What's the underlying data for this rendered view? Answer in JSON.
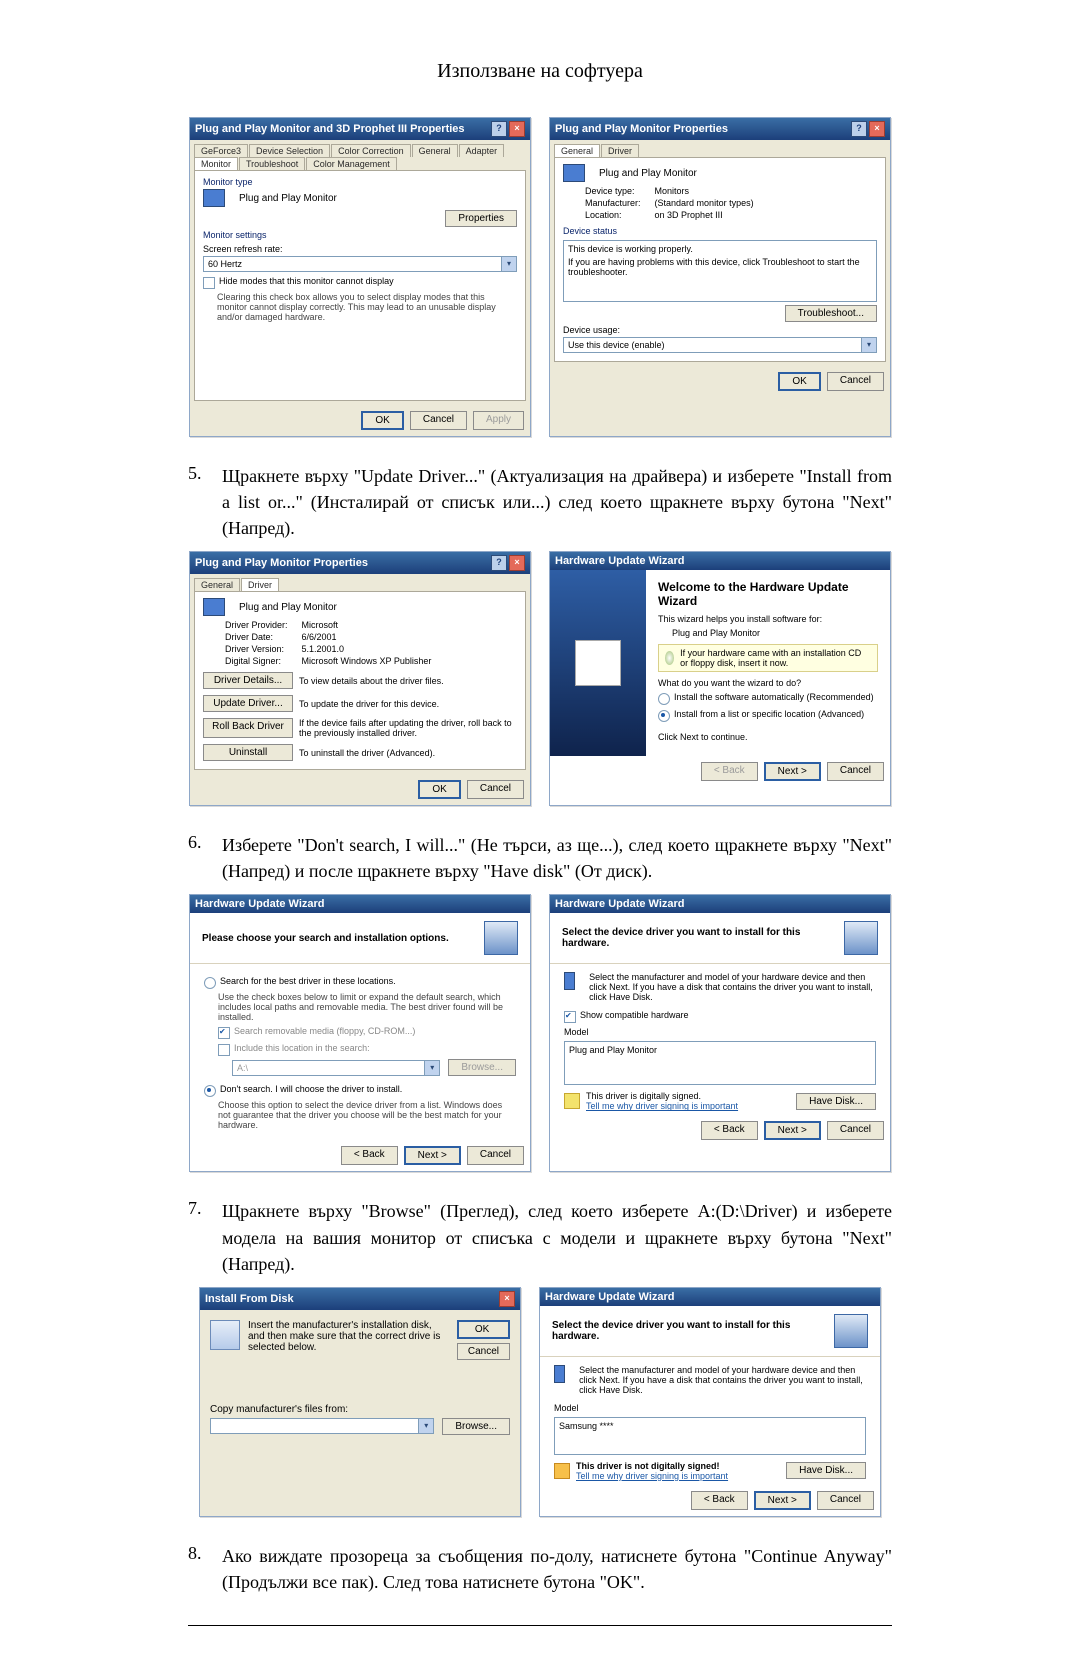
{
  "page_title": "Използване на софтуера",
  "steps": {
    "s5": {
      "num": "5.",
      "text": "Щракнете върху \"Update Driver...\" (Актуализация на драйвера) и изберете \"Install from a list or...\" (Инсталирай от списък или...) след което щракнете върху бутона \"Next\" (Напред)."
    },
    "s6": {
      "num": "6.",
      "text": "Изберете \"Don't search, I will...\" (Не търси, аз ще...), след което щракнете върху \"Next\" (Напред) и после щракнете върху \"Have disk\" (От диск)."
    },
    "s7": {
      "num": "7.",
      "text": "Щракнете върху \"Browse\" (Преглед), след което изберете A:(D:\\Driver) и изберете модела на вашия монитор от списъка с модели и щракнете върху бутона \"Next\" (Напред)."
    },
    "s8": {
      "num": "8.",
      "text": "Ако виждате прозореца за съобщения по-долу, натиснете бутона \"Continue Anyway\" (Продължи все пак). След това натиснете бутона \"OK\"."
    }
  },
  "common": {
    "ok": "OK",
    "cancel": "Cancel",
    "apply": "Apply",
    "back": "< Back",
    "next": "Next >",
    "browse": "Browse...",
    "properties": "Properties"
  },
  "dlg1": {
    "title": "Plug and Play Monitor and 3D Prophet III Properties",
    "tabs": [
      "GeForce3",
      "Device Selection",
      "Color Correction",
      "General",
      "Adapter",
      "Monitor",
      "Troubleshoot",
      "Color Management"
    ],
    "grp_type": "Monitor type",
    "monitor_name": "Plug and Play Monitor",
    "grp_settings": "Monitor settings",
    "refresh_label": "Screen refresh rate:",
    "refresh_value": "60 Hertz",
    "hide_modes": "Hide modes that this monitor cannot display",
    "hide_desc": "Clearing this check box allows you to select display modes that this monitor cannot display correctly. This may lead to an unusable display and/or damaged hardware."
  },
  "dlg2": {
    "title": "Plug and Play Monitor Properties",
    "tabs": [
      "General",
      "Driver"
    ],
    "name": "Plug and Play Monitor",
    "kv": {
      "type_k": "Device type:",
      "type_v": "Monitors",
      "man_k": "Manufacturer:",
      "man_v": "(Standard monitor types)",
      "loc_k": "Location:",
      "loc_v": "on 3D Prophet III"
    },
    "grp_status": "Device status",
    "status_line1": "This device is working properly.",
    "status_line2": "If you are having problems with this device, click Troubleshoot to start the troubleshooter.",
    "troubleshoot": "Troubleshoot...",
    "usage_label": "Device usage:",
    "usage_value": "Use this device (enable)"
  },
  "dlg3": {
    "title": "Plug and Play Monitor Properties",
    "tabs": [
      "General",
      "Driver"
    ],
    "name": "Plug and Play Monitor",
    "kv": {
      "prov_k": "Driver Provider:",
      "prov_v": "Microsoft",
      "date_k": "Driver Date:",
      "date_v": "6/6/2001",
      "ver_k": "Driver Version:",
      "ver_v": "5.1.2001.0",
      "sig_k": "Digital Signer:",
      "sig_v": "Microsoft Windows XP Publisher"
    },
    "btn_details": "Driver Details...",
    "desc_details": "To view details about the driver files.",
    "btn_update": "Update Driver...",
    "desc_update": "To update the driver for this device.",
    "btn_rollback": "Roll Back Driver",
    "desc_rollback": "If the device fails after updating the driver, roll back to the previously installed driver.",
    "btn_uninstall": "Uninstall",
    "desc_uninstall": "To uninstall the driver (Advanced)."
  },
  "wiz1": {
    "title": "Hardware Update Wizard",
    "heading": "Welcome to the Hardware Update Wizard",
    "p1": "This wizard helps you install software for:",
    "p2": "Plug and Play Monitor",
    "info": "If your hardware came with an installation CD or floppy disk, insert it now.",
    "q": "What do you want the wizard to do?",
    "opt1": "Install the software automatically (Recommended)",
    "opt2": "Install from a list or specific location (Advanced)",
    "cont": "Click Next to continue."
  },
  "wiz2": {
    "title": "Hardware Update Wizard",
    "heading": "Please choose your search and installation options.",
    "opt1": "Search for the best driver in these locations.",
    "opt1_desc": "Use the check boxes below to limit or expand the default search, which includes local paths and removable media. The best driver found will be installed.",
    "cb1": "Search removable media (floppy, CD-ROM...)",
    "cb2": "Include this location in the search:",
    "path": "A:\\",
    "opt2": "Don't search. I will choose the driver to install.",
    "opt2_desc": "Choose this option to select the device driver from a list. Windows does not guarantee that the driver you choose will be the best match for your hardware."
  },
  "wiz3": {
    "title": "Hardware Update Wizard",
    "heading": "Select the device driver you want to install for this hardware.",
    "desc": "Select the manufacturer and model of your hardware device and then click Next. If you have a disk that contains the driver you want to install, click Have Disk.",
    "compat": "Show compatible hardware",
    "model_label": "Model",
    "model": "Plug and Play Monitor",
    "signed": "This driver is digitally signed.",
    "signed_link": "Tell me why driver signing is important",
    "have_disk": "Have Disk..."
  },
  "dlgDisk": {
    "title": "Install From Disk",
    "p": "Insert the manufacturer's installation disk, and then make sure that the correct drive is selected below.",
    "copy_label": "Copy manufacturer's files from:",
    "path": ""
  },
  "wiz4": {
    "title": "Hardware Update Wizard",
    "heading": "Select the device driver you want to install for this hardware.",
    "desc": "Select the manufacturer and model of your hardware device and then click Next. If you have a disk that contains the driver you want to install, click Have Disk.",
    "model_label": "Model",
    "model": "Samsung ****",
    "signed": "This driver is not digitally signed!",
    "signed_link": "Tell me why driver signing is important",
    "have_disk": "Have Disk..."
  }
}
